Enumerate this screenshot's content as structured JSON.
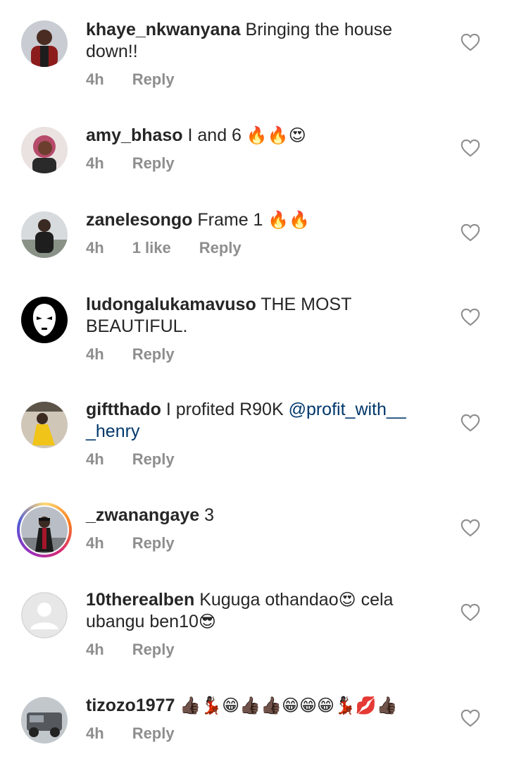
{
  "comments": [
    {
      "username": "khaye_nkwanyana",
      "text": " Bringing the house down!!",
      "emoji": "",
      "time": "4h",
      "likes": "",
      "reply": "Reply",
      "avatar": "man-in-red-jacket"
    },
    {
      "username": "amy_bhaso",
      "text": " I and 6 ",
      "emoji": "🔥🔥😍",
      "time": "4h",
      "likes": "",
      "reply": "Reply",
      "avatar": "woman-pink-hair"
    },
    {
      "username": "zanelesongo",
      "text": " Frame 1 ",
      "emoji": "🔥🔥",
      "time": "4h",
      "likes": "1 like",
      "reply": "Reply",
      "avatar": "woman-outdoors"
    },
    {
      "username": "ludongalukamavuso",
      "text": " THE MOST BEAUTIFUL.",
      "emoji": "",
      "time": "4h",
      "likes": "",
      "reply": "Reply",
      "avatar": "black-logo-face"
    },
    {
      "username": "giftthado",
      "text": " I profited R90K ",
      "mention": "@profit_with__ _henry",
      "emoji": "",
      "time": "4h",
      "likes": "",
      "reply": "Reply",
      "avatar": "woman-yellow-dress"
    },
    {
      "username": "_zwanangaye",
      "text": " 3",
      "emoji": "",
      "time": "4h",
      "likes": "",
      "reply": "Reply",
      "avatar": "person-graduation",
      "story": true
    },
    {
      "username": "10therealben",
      "text": " Kuguga othandao",
      "emoji": "😍",
      "text2": " cela ubangu ben10",
      "emoji2": "😎",
      "time": "4h",
      "likes": "",
      "reply": "Reply",
      "avatar": "default-profile"
    },
    {
      "username": "tizozo1977",
      "text": " ",
      "emoji": "👍🏿💃🏿😁👍🏿👍🏿😁😁😁💃🏿💋👍🏿",
      "time": "4h",
      "likes": "",
      "reply": "Reply",
      "avatar": "truck-photo"
    }
  ],
  "icons": {
    "like": "heart-outline-icon"
  },
  "colors": {
    "text": "#262626",
    "meta": "#8e8e8e",
    "mention": "#00376b"
  }
}
